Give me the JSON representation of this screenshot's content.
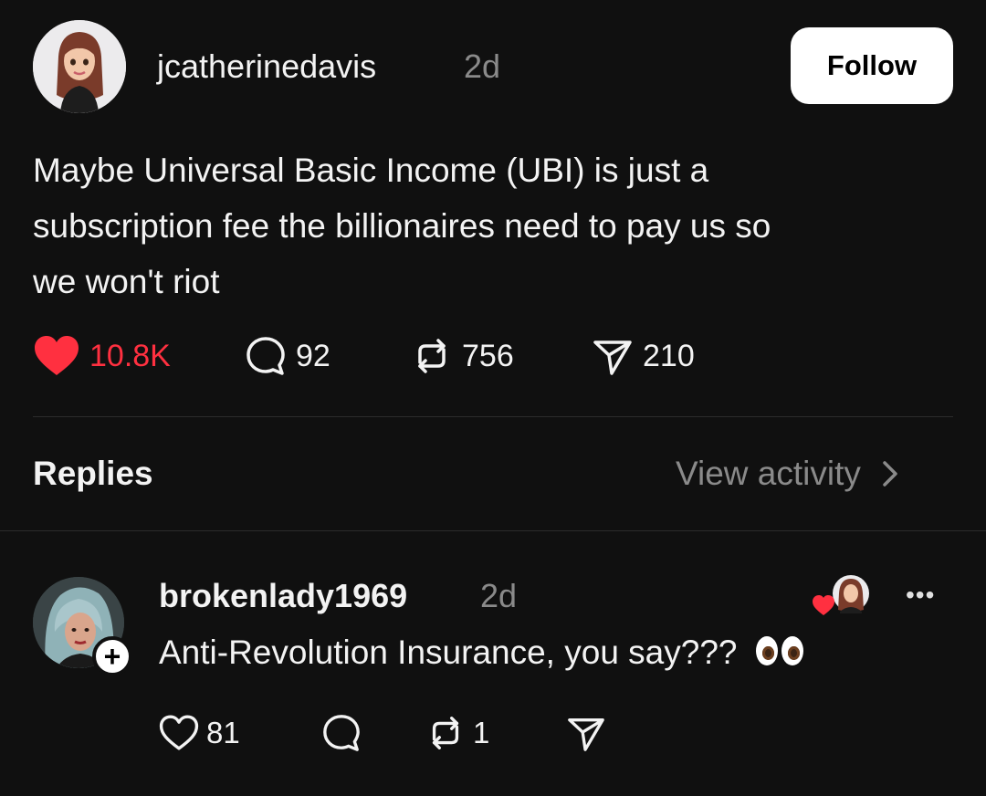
{
  "post": {
    "username": "jcatherinedavis",
    "time": "2d",
    "follow_label": "Follow",
    "text_lines": [
      "Maybe Universal Basic Income (UBI) is just a",
      "subscription fee the billionaires need to pay us so",
      "we won't riot"
    ],
    "likes": "10.8K",
    "replies": "92",
    "reposts": "756",
    "shares": "210",
    "liked": true
  },
  "section": {
    "replies_label": "Replies",
    "view_activity_label": "View activity"
  },
  "reply": {
    "username": "brokenlady1969",
    "time": "2d",
    "text": "Anti-Revolution Insurance, you say???",
    "likes": "81",
    "reposts": "1",
    "more_label": "•••"
  },
  "colors": {
    "background": "#101010",
    "like_red": "#ff3040",
    "muted": "#8a8a8a",
    "divider": "#2b2b2b"
  },
  "icons": [
    "heart-icon",
    "comment-icon",
    "repost-icon",
    "share-icon",
    "chevron-right-icon",
    "plus-icon",
    "more-icon"
  ]
}
